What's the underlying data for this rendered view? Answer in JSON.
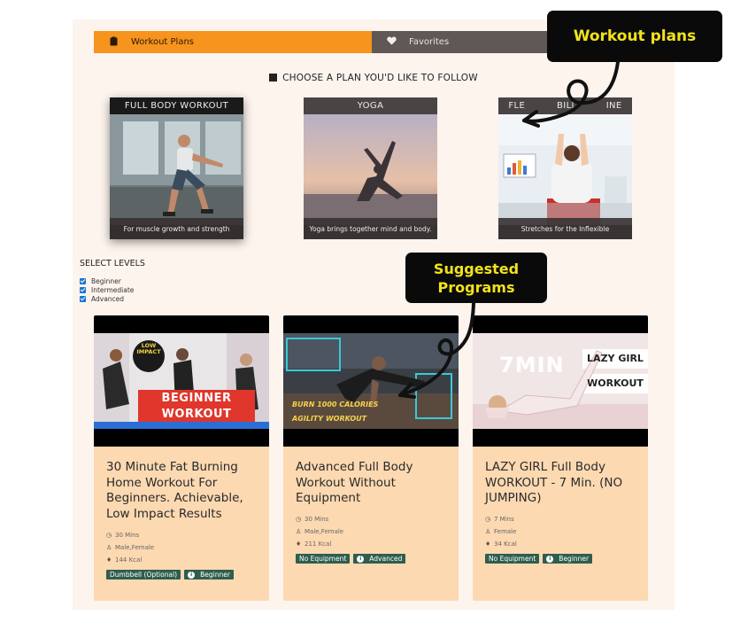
{
  "tabs": [
    {
      "label": "Workout Plans",
      "icon": "clipboard-icon",
      "active": true
    },
    {
      "label": "Favorites",
      "icon": "heart-icon",
      "active": false
    }
  ],
  "choose_heading": "CHOOSE A PLAN YOU'D LIKE TO FOLLOW",
  "plans": [
    {
      "title": "FULL BODY WORKOUT",
      "caption": "For muscle growth and strength",
      "selected": true
    },
    {
      "title": "YOGA",
      "caption": "Yoga brings together mind and body.",
      "selected": false
    },
    {
      "title": "FLEXIBILITY ROUTINE",
      "title_visible": "FLE          BILI          INE",
      "caption": "Stretches for the Inflexible",
      "selected": false
    }
  ],
  "levels": {
    "title": "SELECT LEVELS",
    "items": [
      "Beginner",
      "Intermediate",
      "Advanced"
    ]
  },
  "programs": [
    {
      "title": "30 Minute Fat Burning Home Workout For Beginners. Achievable, Low Impact Results",
      "thumb_text_1": "LOW IMPACT",
      "thumb_text_2": "BEGINNER",
      "thumb_text_3": "WORKOUT",
      "duration": "30 Mins",
      "gender": "Male,Female",
      "calories": "144 Kcal",
      "equipment": "Dumbbell (Optional)",
      "level": "Beginner"
    },
    {
      "title": "Advanced Full Body Workout Without Equipment",
      "thumb_text_1": "BURN 1000 CALORIES",
      "thumb_text_2": "AGILITY WORKOUT",
      "duration": "30 Mins",
      "gender": "Male,Female",
      "calories": "211 Kcal",
      "equipment": "No Equipment",
      "level": "Advanced"
    },
    {
      "title": "LAZY GIRL Full Body WORKOUT - 7 Min. (NO JUMPING)",
      "thumb_text_1": "7MIN",
      "thumb_text_2": "LAZY GIRL",
      "thumb_text_3": "WORKOUT",
      "duration": "7 Mins",
      "gender": "Female",
      "calories": "34 Kcal",
      "equipment": "No Equipment",
      "level": "Beginner"
    }
  ],
  "callouts": {
    "workout_plans": "Workout plans",
    "suggested_line1": "Suggested",
    "suggested_line2": "Programs"
  },
  "colors": {
    "accent": "#f7941d",
    "tab_inactive": "#5f5855",
    "card_bg": "#fcd9b1",
    "tag_bg": "#2e5e4e",
    "callout_text": "#f2e21b"
  }
}
